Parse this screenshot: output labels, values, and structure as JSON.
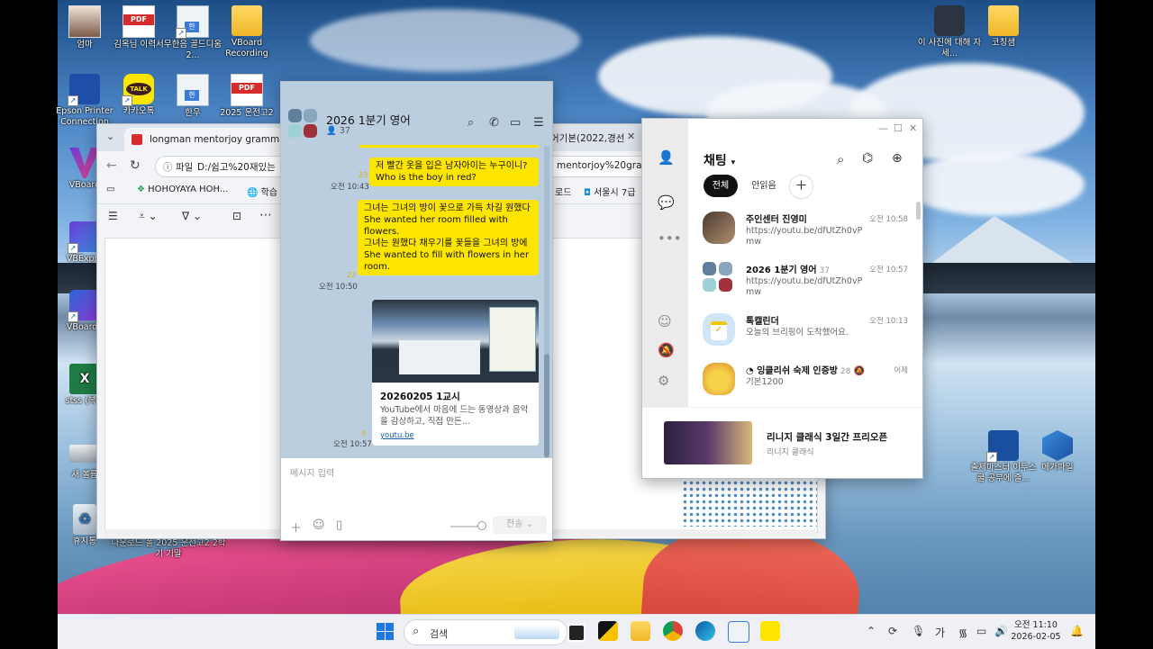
{
  "desktop_icons": [
    {
      "label": "엄마",
      "kind": "photo"
    },
    {
      "label": "김옥님 이력서",
      "kind": "pdf"
    },
    {
      "label": "무한음 골드디움 2...",
      "kind": "hwp"
    },
    {
      "label": "VBoard Recording",
      "kind": "folder"
    },
    {
      "label": "Epson Printer Connection",
      "kind": "app"
    },
    {
      "label": "카카오톡",
      "kind": "talk"
    },
    {
      "label": "한우",
      "kind": "hwp"
    },
    {
      "label": "2025 운전고2",
      "kind": "pdf"
    },
    {
      "label": "VBoard",
      "kind": "app"
    },
    {
      "label": "VBExpre",
      "kind": "app"
    },
    {
      "label": "VBoardP",
      "kind": "app"
    },
    {
      "label": "stss (복구",
      "kind": "excel"
    },
    {
      "label": "새 볼륨",
      "kind": "drive"
    },
    {
      "label": "휴지통",
      "kind": "recycle"
    },
    {
      "label": "다운로드 폴 2025 운전고2 2학기 기말",
      "kind": "text"
    },
    {
      "label": "이 사진에 대해 자세...",
      "kind": "app"
    },
    {
      "label": "코칭샘",
      "kind": "folder"
    },
    {
      "label": "출제마스터 이투스쿨 공부에 줄...",
      "kind": "app"
    },
    {
      "label": "메가파일",
      "kind": "app"
    }
  ],
  "browser": {
    "tab1": "longman mentorjoy grammar plus",
    "tab2": "어기본(2022,경선",
    "address_prefix": "파일",
    "address": "D:/쉼고%20재있는",
    "address_right": "mentorjoy%20gra...",
    "bookmark1": "HOHOYAYA  HOH...",
    "bookmark2": "학습",
    "bookmark3": "로드",
    "bookmark4": "서울시 7급"
  },
  "chatroom": {
    "title": "2026 1분기 영어",
    "member_count": "37",
    "messages": [
      {
        "text": "저 빨간 옷을 입은 남자아이는 누구이니?\nWho is the boy in red?",
        "time": "오전 10:43",
        "read": "23"
      },
      {
        "text": "그녀는 그녀의 방이 꽃으로 가득 차길 원했다\nShe wanted her room filled with flowers.\n그녀는 원했다 채우기를 꽃들을 그녀의 방에\nShe wanted to fill with flowers in her room.",
        "time": "오전 10:50",
        "read": "22"
      }
    ],
    "link_card": {
      "title": "20260205 1교시",
      "description": "YouTube에서 마음에 드는 동영상과 음악을 감상하고, 직접 만든...",
      "domain": "youtu.be",
      "time": "오전 10:57",
      "read": "3"
    },
    "input_placeholder": "메시지 입력",
    "send_label": "전송"
  },
  "kakao": {
    "title": "채팅",
    "filter_all": "전체",
    "filter_unread": "안읽음",
    "chats": [
      {
        "name": "주인센터 진영미",
        "count": "",
        "preview": "https://youtu.be/dfUtZh0vPmw",
        "time": "오전 10:58"
      },
      {
        "name": "2026 1분기 영어",
        "count": "37",
        "preview": "https://youtu.be/dfUtZh0vPmw",
        "time": "오전 10:57"
      },
      {
        "name": "톡캘린더",
        "count": "",
        "preview": "오늘의 브리핑이 도착했어요.",
        "time": "오전 10:13"
      },
      {
        "name": "잉클리쉬 숙제 인증방",
        "count": "28",
        "preview": "기본1200",
        "time": "어제"
      }
    ],
    "ad_title": "리니지 클래식 3일간 프리오픈",
    "ad_sub": "리니지 클래식"
  },
  "taskbar": {
    "search_label": "검색",
    "ime": "가",
    "time": "오전 11:10",
    "date": "2026-02-05"
  }
}
